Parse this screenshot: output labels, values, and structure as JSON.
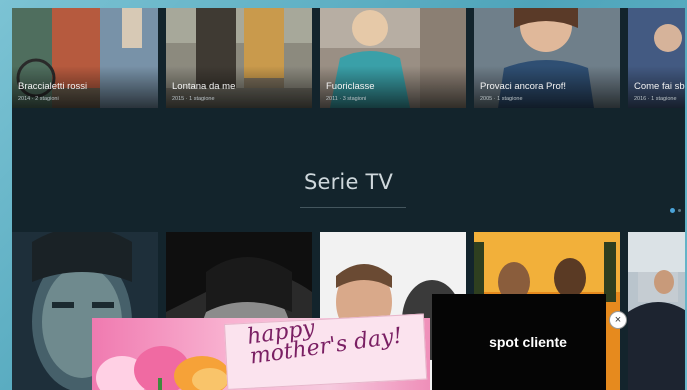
{
  "top_row": [
    {
      "title": "Braccialetti rossi",
      "meta": "2014 · 2 stagioni"
    },
    {
      "title": "Lontana da me",
      "meta": "2015 · 1 stagione"
    },
    {
      "title": "Fuoriclasse",
      "meta": "2011 · 3 stagioni"
    },
    {
      "title": "Provaci ancora Prof!",
      "meta": "2005 · 1 stagione"
    },
    {
      "title": "Come fai sb",
      "meta": "2016 · 1 stagione"
    }
  ],
  "section": {
    "title": "Serie TV"
  },
  "ad": {
    "greeting": "happy mother's day!",
    "spot_label": "spot cliente",
    "close_symbol": "×"
  },
  "colors": {
    "background": "#13242c",
    "accent": "#4aa3d8"
  }
}
